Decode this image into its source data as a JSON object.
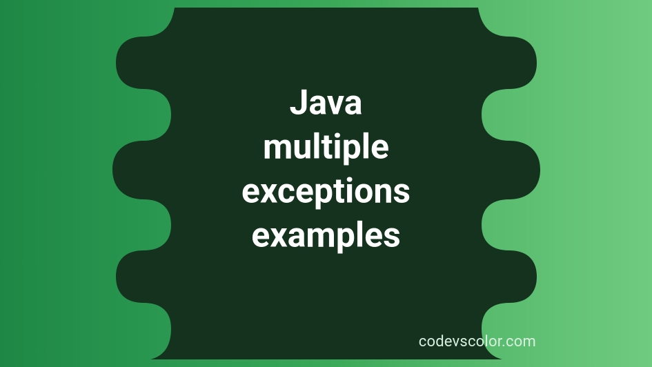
{
  "title_text": "Java\nmultiple\nexceptions\nexamples",
  "watermark_text": "codevscolor.com",
  "colors": {
    "blob_fill": "#14321e",
    "text": "#ffffff",
    "watermark": "#d9f0e0"
  }
}
